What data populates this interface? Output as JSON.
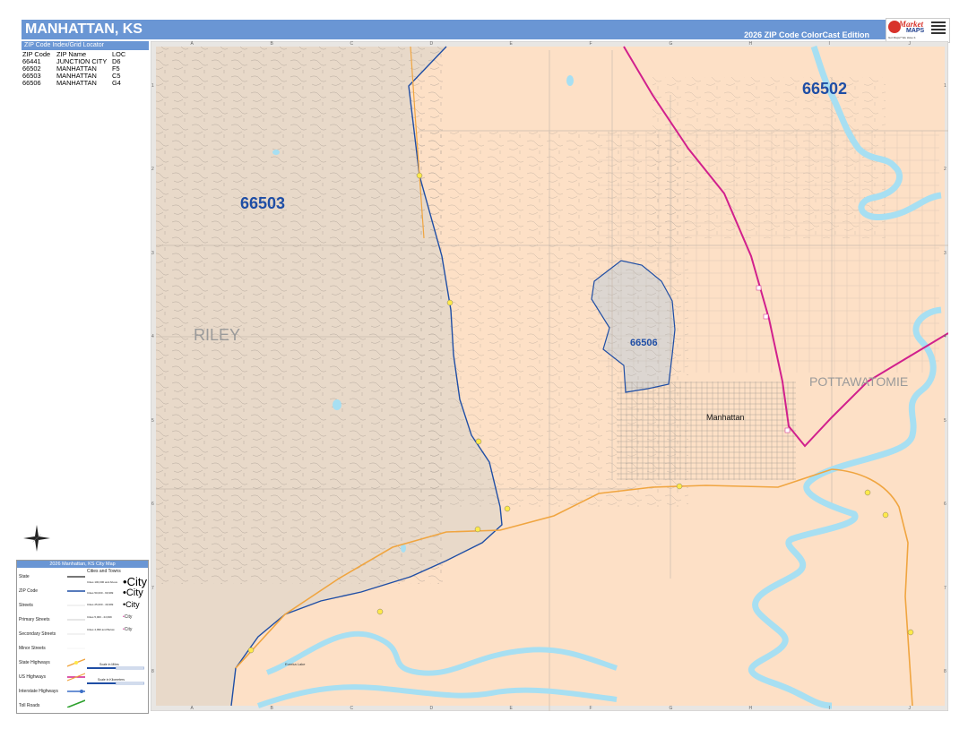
{
  "header": {
    "title": "MANHATTAN, KS",
    "edition": "2026 ZIP Code ColorCast Edition"
  },
  "logo": {
    "brand_top": "Market",
    "brand_bottom": "MAPS",
    "tagline": "Got Maps? We Have It."
  },
  "zip_index": {
    "header": "ZIP Code Index/Grid Locator",
    "columns": [
      "ZIP Code",
      "ZIP Name",
      "LOC"
    ],
    "rows": [
      [
        "66441",
        "JUNCTION CITY",
        "D6"
      ],
      [
        "66502",
        "MANHATTAN",
        "F5"
      ],
      [
        "66503",
        "MANHATTAN",
        "C5"
      ],
      [
        "66506",
        "MANHATTAN",
        "G4"
      ]
    ]
  },
  "map": {
    "zip_labels": {
      "z66502": "66502",
      "z66503": "66503",
      "z66506": "66506"
    },
    "county_labels": {
      "riley": "RILEY",
      "pottawatomie": "POTTAWATOMIE"
    },
    "place_labels": {
      "manhattan": "Manhattan",
      "eureka_lake": "Eureka Lake"
    },
    "grid_columns": [
      "A",
      "B",
      "C",
      "D",
      "E",
      "F",
      "G",
      "H",
      "I",
      "J"
    ],
    "grid_rows": [
      "1",
      "2",
      "3",
      "4",
      "5",
      "6",
      "7",
      "8"
    ],
    "colors": {
      "zip_66502": "#fde0c6",
      "zip_66503": "#e8d9c9",
      "zip_66506": "#dcd6d1",
      "water": "#a7dff2",
      "zip_boundary": "#1f4ea5",
      "us_highway": "#d1208d",
      "state_highway": "#f0a540",
      "label_blue": "#1f4ea5"
    }
  },
  "legend": {
    "title": "2026 Manhattan, KS City Map",
    "items": [
      "State",
      "ZIP Code",
      "Streets",
      "Primary Streets",
      "Secondary Streets",
      "Minor Streets",
      "State Highways",
      "US Highways",
      "Interstate Highways",
      "Toll Roads"
    ],
    "cities_header": "Cities and Towns",
    "city_classes": [
      "Cities 100,000 and Above",
      "Cities 50,000 - 99,999",
      "Cities 25,000 - 49,999",
      "Cities 5,000 - 24,999",
      "Cities 4,999 and Below"
    ],
    "city_samples": [
      "City",
      "City",
      "City",
      "City",
      "City"
    ],
    "scale_miles": "Scale in Miles",
    "scale_km": "Scale in Kilometers"
  }
}
